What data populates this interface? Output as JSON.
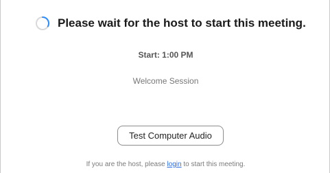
{
  "header": {
    "spinner_icon": "loading-spinner-icon",
    "spinner_color": "#2d8cff",
    "title": "Please wait for the host to start this meeting."
  },
  "meeting": {
    "start_time": "Start: 1:00 PM",
    "topic": "Welcome Session"
  },
  "actions": {
    "test_audio_label": "Test Computer Audio"
  },
  "footer": {
    "text_before": "If you are the host, please ",
    "login_link": "login",
    "text_after": " to start this meeting.",
    "link_color": "#2d6ce5"
  }
}
